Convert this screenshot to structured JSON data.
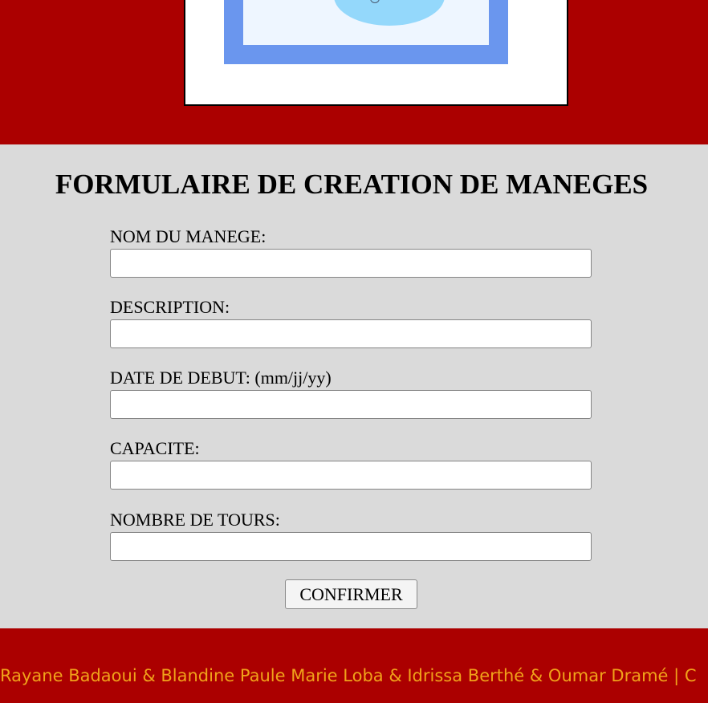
{
  "colors": {
    "header_bg": "#ab0000",
    "page_bg": "#dadada",
    "footer_text": "#f0a21a",
    "logo_blue": "#6a96ee",
    "logo_pool": "#94d8fb"
  },
  "header": {
    "logo_icon": "amusement-park-logo-icon"
  },
  "form": {
    "title": "FORMULAIRE DE CREATION DE MANEGES",
    "fields": [
      {
        "label": "NOM DU MANEGE:",
        "value": "",
        "placeholder": ""
      },
      {
        "label": "DESCRIPTION:",
        "value": "",
        "placeholder": ""
      },
      {
        "label": "DATE DE DEBUT: (mm/jj/yy)",
        "value": "",
        "placeholder": ""
      },
      {
        "label": "CAPACITE:",
        "value": "",
        "placeholder": ""
      },
      {
        "label": "NOMBRE DE TOURS:",
        "value": "",
        "placeholder": ""
      }
    ],
    "submit_label": "CONFIRMER"
  },
  "footer": {
    "credits": "Rayane Badaoui & Blandine Paule Marie Loba & Idrissa Berthé & Oumar Dramé | C"
  }
}
